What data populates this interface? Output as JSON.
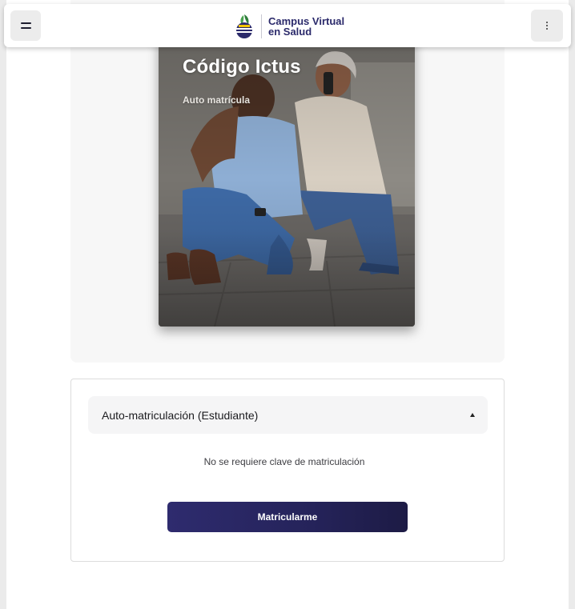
{
  "header": {
    "logo_line1": "Campus Virtual",
    "logo_line2": "en Salud",
    "menu_icon": "hamburger-icon",
    "more_icon": "more-vertical-icon"
  },
  "course": {
    "title": "Código Ictus",
    "subtitle": "Auto matrícula"
  },
  "enrolment": {
    "method_title": "Auto-matriculación (Estudiante)",
    "note": "No se requiere clave de matriculación",
    "button_label": "Matricularme",
    "expanded": true
  },
  "colors": {
    "brand_navy": "#2b2a6b",
    "button_start": "#2e2b6e",
    "button_end": "#1d1b45"
  }
}
